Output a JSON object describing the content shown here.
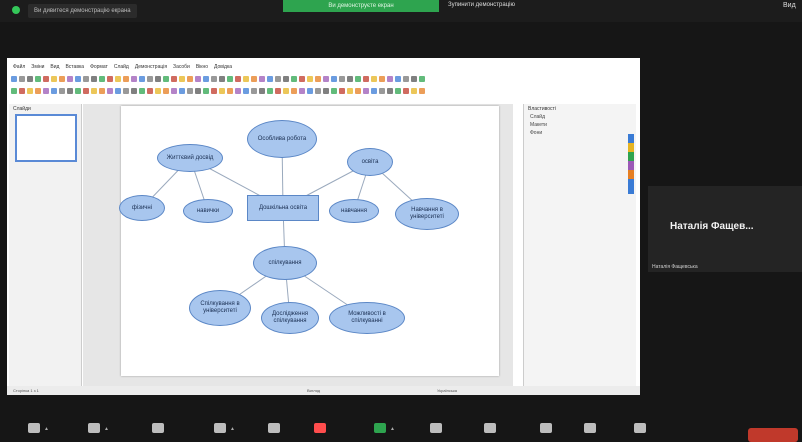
{
  "meeting": {
    "top_notice": "Ви дивитеся демонстрацію екрана",
    "share_banner": "Ви демонструєте екран",
    "stop_share_label": "Зупинити демонстрацію",
    "top_right_label": "Вид"
  },
  "app": {
    "menu": [
      "Файл",
      "Зміни",
      "Вид",
      "Вставка",
      "Формат",
      "Слайд",
      "Демонстрація",
      "Засоби",
      "Вікно",
      "Довідка"
    ],
    "slides_panel_title": "Слайди",
    "sidebar_title": "Властивості",
    "sidebar_items": [
      "Слайд",
      "Макети",
      "Фони"
    ],
    "status_left": "Сторінка 1 з 1",
    "status_middle": "Вигляд",
    "status_right": "Українська"
  },
  "mindmap": {
    "nodes": [
      {
        "id": "center",
        "label": "Дошкільна освіта",
        "shape": "rect"
      },
      {
        "id": "n1",
        "label": "Особлива робота",
        "shape": "ellipse"
      },
      {
        "id": "n2",
        "label": "Життєвий досвід",
        "shape": "ellipse"
      },
      {
        "id": "n3",
        "label": "освіта",
        "shape": "ellipse"
      },
      {
        "id": "n4",
        "label": "фізичні",
        "shape": "ellipse"
      },
      {
        "id": "n5",
        "label": "навички",
        "shape": "ellipse"
      },
      {
        "id": "n6",
        "label": "навчання",
        "shape": "ellipse"
      },
      {
        "id": "n7",
        "label": "Навчання в університеті",
        "shape": "ellipse"
      },
      {
        "id": "n8",
        "label": "спілкування",
        "shape": "ellipse"
      },
      {
        "id": "n9",
        "label": "Спілкування в університеті",
        "shape": "ellipse"
      },
      {
        "id": "n10",
        "label": "Дослідження спілкування",
        "shape": "ellipse"
      },
      {
        "id": "n11",
        "label": "Можливості в спілкуванні",
        "shape": "ellipse"
      }
    ],
    "links": [
      [
        "center",
        "n1"
      ],
      [
        "center",
        "n2"
      ],
      [
        "center",
        "n3"
      ],
      [
        "center",
        "n8"
      ],
      [
        "n2",
        "n4"
      ],
      [
        "n2",
        "n5"
      ],
      [
        "n3",
        "n6"
      ],
      [
        "n3",
        "n7"
      ],
      [
        "n8",
        "n9"
      ],
      [
        "n8",
        "n10"
      ],
      [
        "n8",
        "n11"
      ]
    ]
  },
  "participant": {
    "name": "Наталія Фащев...",
    "label": "Наталія Фащевська"
  },
  "colors": {
    "node_fill": "#a8c6ee",
    "node_border": "#5b87c6",
    "share_green": "#2ea44f",
    "leave_red": "#c0392b"
  }
}
